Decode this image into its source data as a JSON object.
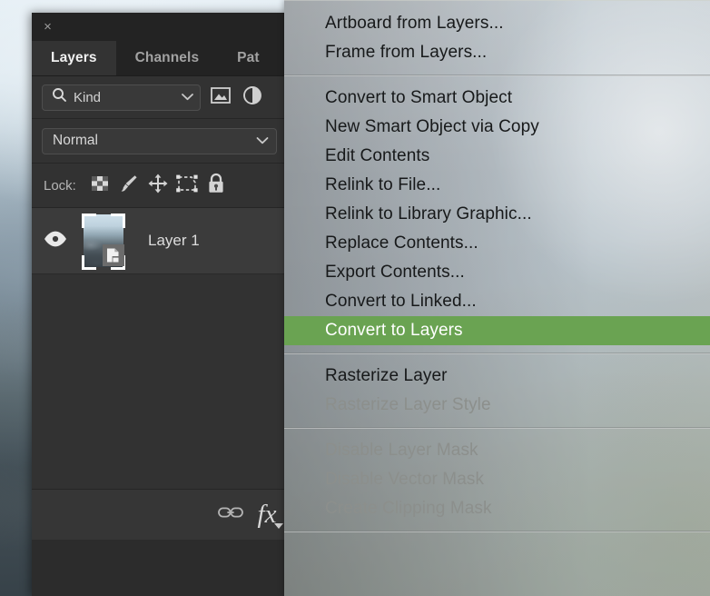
{
  "app": {
    "name": "photoshop-layers-panel"
  },
  "panel": {
    "close_label": "×",
    "tabs": [
      {
        "label": "Layers",
        "active": true
      },
      {
        "label": "Channels",
        "active": false
      },
      {
        "label": "Pat",
        "active": false
      }
    ],
    "filter": {
      "search_icon": "search-icon",
      "kind_label": "Kind",
      "chevron": "chevron-down-icon",
      "quick_filters": [
        {
          "icon": "image-filter-icon"
        },
        {
          "icon": "adjustment-filter-icon"
        }
      ]
    },
    "blend": {
      "mode": "Normal",
      "chevron": "chevron-down-icon"
    },
    "lock": {
      "label": "Lock:",
      "icons": [
        "lock-transparent-pixels-icon",
        "lock-image-pixels-icon",
        "lock-position-icon",
        "lock-artboard-nesting-icon",
        "lock-all-icon"
      ]
    },
    "layers": [
      {
        "name": "Layer 1",
        "visible": true,
        "eye_icon": "eye-icon",
        "badge": "smart-object-badge-icon",
        "selected": true
      }
    ],
    "footer": {
      "link_icon": "link-layers-icon",
      "fx_label": "fx",
      "fx_caret": "caret-down-icon"
    }
  },
  "context_menu": {
    "highlight_color": "#6aa352",
    "groups": [
      {
        "items": [
          {
            "label": "Artboard from Layers...",
            "state": "enabled"
          },
          {
            "label": "Frame from Layers...",
            "state": "enabled"
          }
        ]
      },
      {
        "items": [
          {
            "label": "Convert to Smart Object",
            "state": "enabled"
          },
          {
            "label": "New Smart Object via Copy",
            "state": "enabled"
          },
          {
            "label": "Edit Contents",
            "state": "enabled"
          },
          {
            "label": "Relink to File...",
            "state": "enabled"
          },
          {
            "label": "Relink to Library Graphic...",
            "state": "enabled"
          },
          {
            "label": "Replace Contents...",
            "state": "enabled"
          },
          {
            "label": "Export Contents...",
            "state": "enabled"
          },
          {
            "label": "Convert to Linked...",
            "state": "enabled"
          },
          {
            "label": "Convert to Layers",
            "state": "selected"
          }
        ]
      },
      {
        "items": [
          {
            "label": "Rasterize Layer",
            "state": "enabled"
          },
          {
            "label": "Rasterize Layer Style",
            "state": "disabled"
          }
        ]
      },
      {
        "items": [
          {
            "label": "Disable Layer Mask",
            "state": "disabled"
          },
          {
            "label": "Disable Vector Mask",
            "state": "disabled"
          },
          {
            "label": "Create Clipping Mask",
            "state": "disabled"
          }
        ]
      },
      {
        "items": []
      }
    ]
  }
}
